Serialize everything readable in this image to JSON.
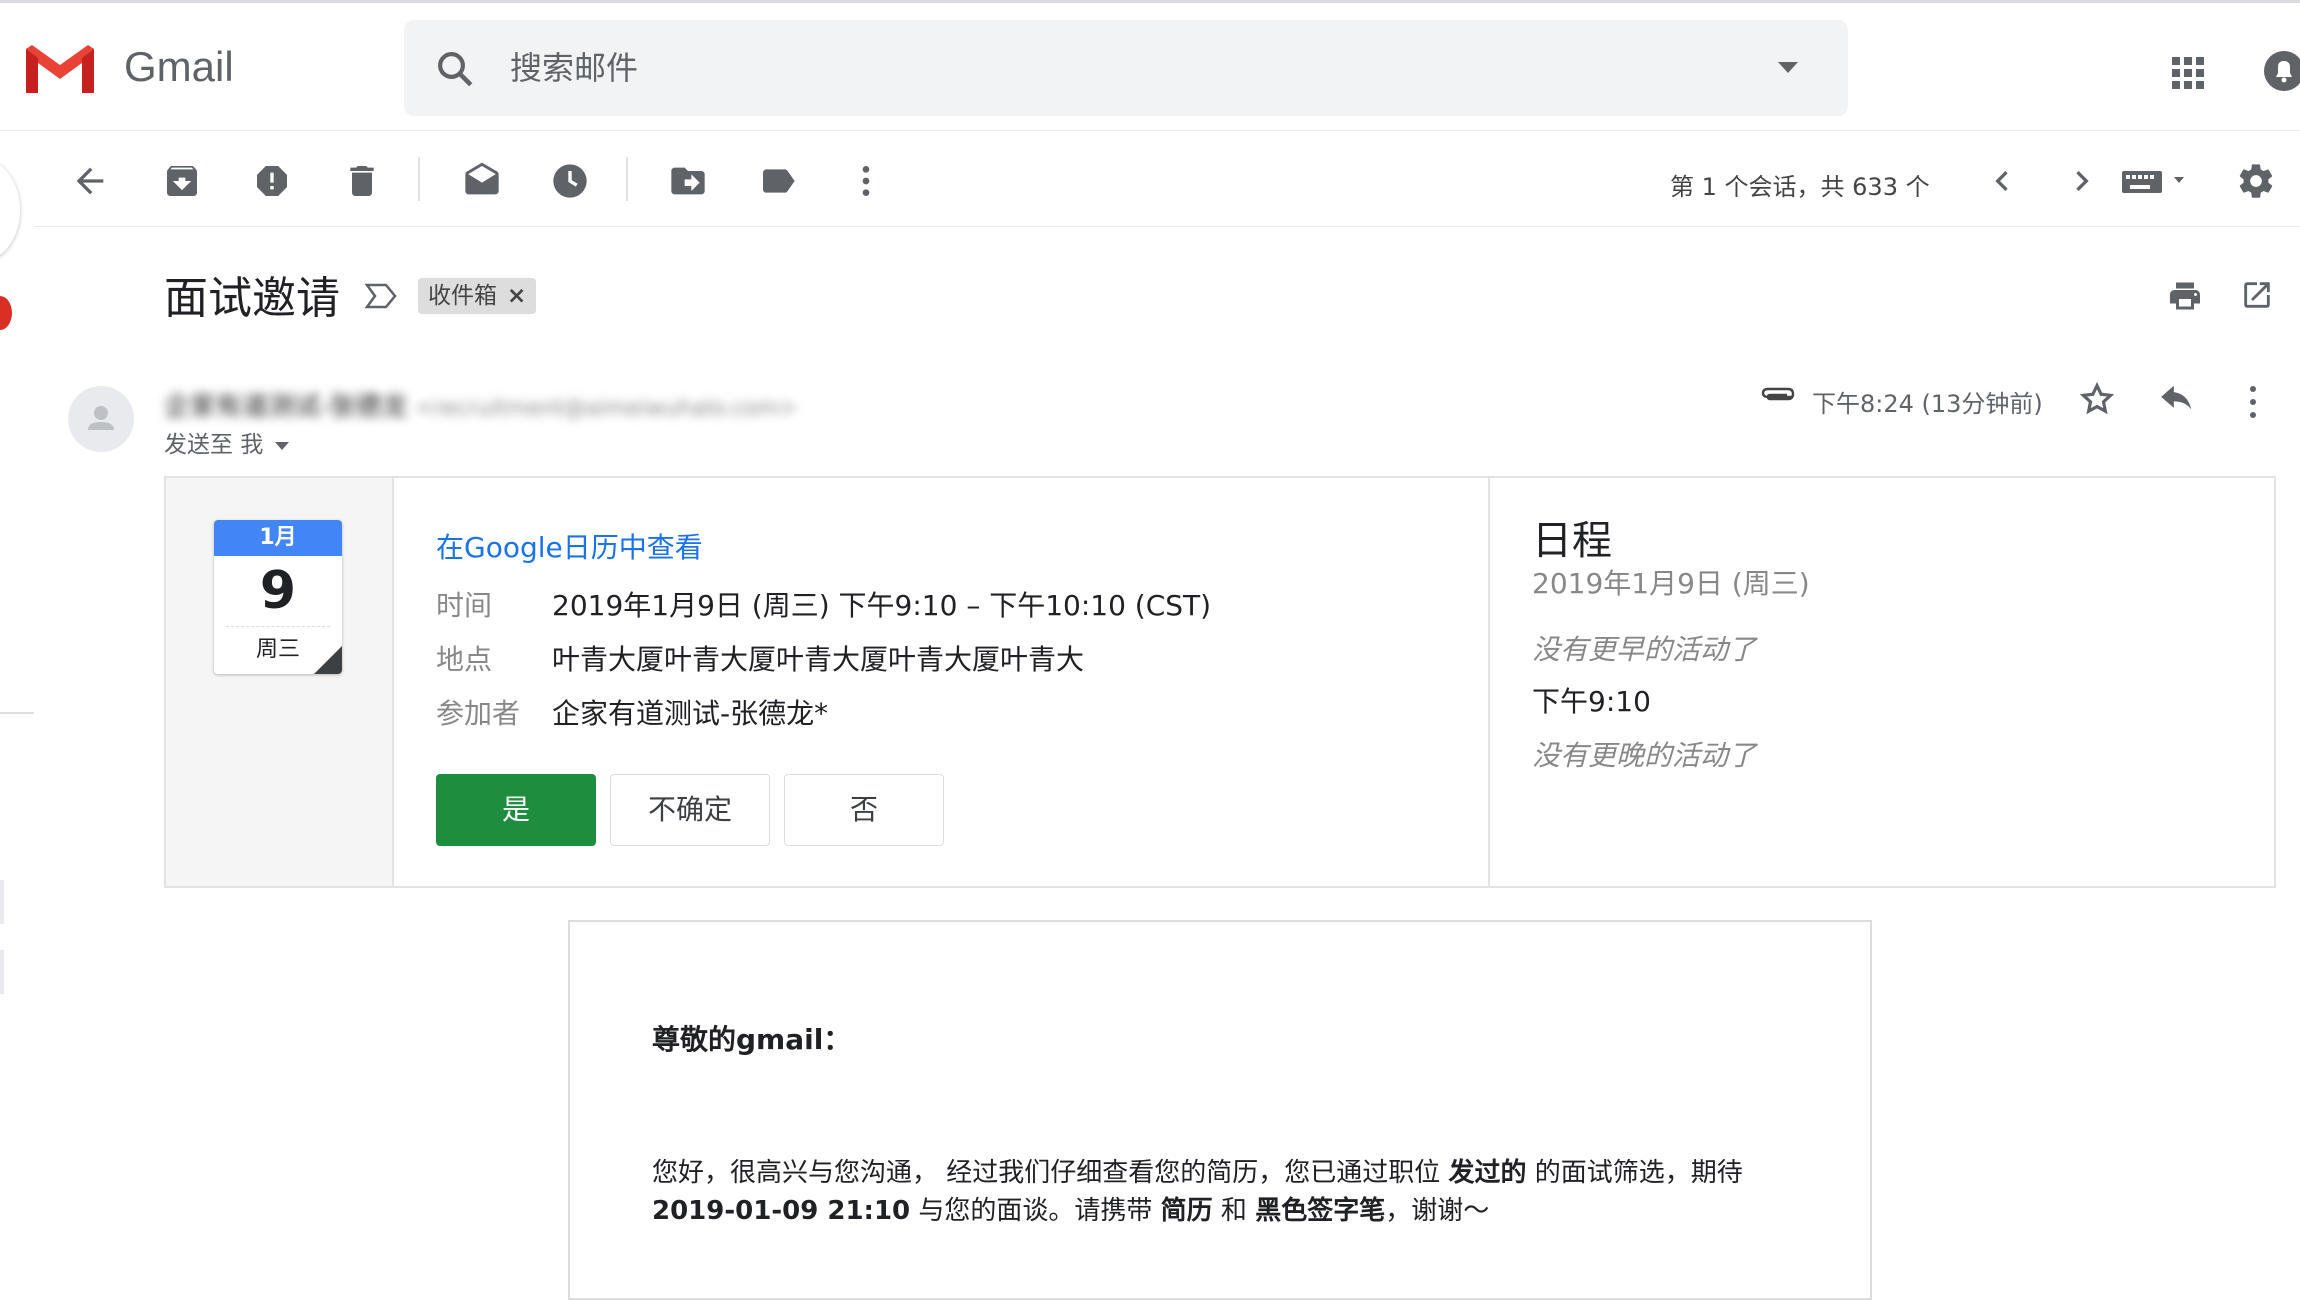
{
  "app": {
    "name": "Gmail"
  },
  "search": {
    "placeholder": "搜索邮件"
  },
  "toolbar": {
    "page_info": "第 1 个会话，共 633 个"
  },
  "thread": {
    "subject": "面试邀请",
    "label": "收件箱",
    "label_remove": "×"
  },
  "sender": {
    "name": "企家有道测试-张德龙",
    "email": "<recruitment@aimeiwuhalo.com>",
    "send_to": "发送至 我",
    "time": "下午8:24 (13分钟前)"
  },
  "invite": {
    "cal_month": "1月",
    "cal_day": "9",
    "cal_weekday": "周三",
    "view_link": "在Google日历中查看",
    "time_label": "时间",
    "time_value": "2019年1月9日 (周三) 下午9:10 – 下午10:10 (CST)",
    "location_label": "地点",
    "location_value": "叶青大厦叶青大厦叶青大厦叶青大厦叶青大",
    "attendees_label": "参加者",
    "attendees_value": "企家有道测试-张德龙*",
    "btn_yes": "是",
    "btn_maybe": "不确定",
    "btn_no": "否"
  },
  "agenda": {
    "title": "日程",
    "date": "2019年1月9日 (周三)",
    "no_earlier": "没有更早的活动了",
    "event_time": "下午9:10",
    "no_later": "没有更晚的活动了"
  },
  "body": {
    "greeting": "尊敬的gmail：",
    "p1": "您好，很高兴与您沟通， 经过我们仔细查看您的简历，您已通过职位 ",
    "p1_b1": "发过的",
    "p1_2": " 的面试筛选，期待 ",
    "p1_b2": "2019-01-09 21:10",
    "p1_3": " 与您的面谈。请携带 ",
    "p1_b3": "简历",
    "p1_4": " 和 ",
    "p1_b4": "黑色签字笔",
    "p1_5": "，谢谢～"
  },
  "colors": {
    "accept": "#1e8e3e",
    "link": "#1a73e8",
    "calendar": "#4285f4",
    "gmail_red": "#d93025"
  }
}
